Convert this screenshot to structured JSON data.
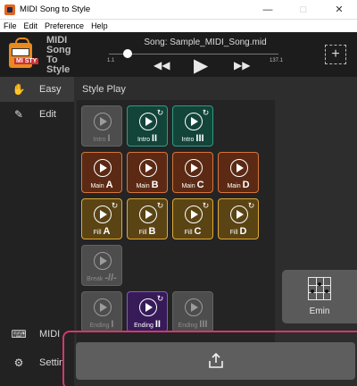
{
  "window": {
    "title": "MIDI Song to Style",
    "minimize_glyph": "—",
    "maximize_glyph": "□",
    "close_glyph": "✕"
  },
  "menu": [
    "File",
    "Edit",
    "Preference",
    "Help"
  ],
  "header": {
    "logo_lines": [
      "MIDI",
      "Song",
      "To",
      "Style"
    ],
    "logo_badge": "MI STY",
    "song_title": "Song: Sample_MIDI_Song.mid",
    "position_start": "1.1",
    "position_end": "137.1",
    "position_fraction": 0.08,
    "rewind_glyph": "◀◀",
    "play_glyph": "▶",
    "forward_glyph": "▶▶",
    "add_glyph": "+"
  },
  "sidebar": {
    "items": [
      {
        "label": "Easy",
        "icon": "easy-hand-icon",
        "glyph": "✋",
        "active": true
      },
      {
        "label": "Edit",
        "icon": "edit-pencil-icon",
        "glyph": "✎",
        "active": false
      },
      {
        "label": "MIDI",
        "icon": "midi-keyboard-icon",
        "glyph": "⌨",
        "active": false
      },
      {
        "label": "Settin",
        "icon": "gear-icon",
        "glyph": "⚙",
        "active": false
      }
    ]
  },
  "main": {
    "title": "Style Play",
    "pads": {
      "intro": [
        {
          "prefix": "Intro",
          "letter": "I",
          "color": "gray",
          "loop": false
        },
        {
          "prefix": "Intro",
          "letter": "II",
          "color": "green",
          "loop": true
        },
        {
          "prefix": "Intro",
          "letter": "III",
          "color": "green",
          "loop": true
        }
      ],
      "main": [
        {
          "prefix": "Main",
          "letter": "A",
          "color": "orange",
          "loop": false
        },
        {
          "prefix": "Main",
          "letter": "B",
          "color": "orange",
          "loop": false
        },
        {
          "prefix": "Main",
          "letter": "C",
          "color": "orange",
          "loop": false
        },
        {
          "prefix": "Main",
          "letter": "D",
          "color": "orange",
          "loop": false
        }
      ],
      "fill": [
        {
          "prefix": "Fill",
          "letter": "A",
          "color": "gold",
          "loop": true
        },
        {
          "prefix": "Fill",
          "letter": "B",
          "color": "gold",
          "loop": true
        },
        {
          "prefix": "Fill",
          "letter": "C",
          "color": "gold",
          "loop": true
        },
        {
          "prefix": "Fill",
          "letter": "D",
          "color": "gold",
          "loop": true
        }
      ],
      "break": [
        {
          "prefix": "Break",
          "letter": "-//-",
          "color": "gray",
          "loop": false
        }
      ],
      "ending": [
        {
          "prefix": "Ending",
          "letter": "I",
          "color": "gray",
          "loop": false
        },
        {
          "prefix": "Ending",
          "letter": "II",
          "color": "purple",
          "loop": true
        },
        {
          "prefix": "Ending",
          "letter": "III",
          "color": "gray",
          "loop": false
        }
      ]
    },
    "loop_glyph": "↻",
    "chord": {
      "name": "Emin",
      "icon": "chord-diagram-icon"
    },
    "share": {
      "icon": "share-export-icon"
    }
  },
  "colors": {
    "accent_easy": "#f0a030",
    "highlight_border": "#d3386a",
    "pad_green": "#2f9c82",
    "pad_orange": "#d8743a",
    "pad_gold": "#e0a836",
    "pad_purple": "#8a56d2"
  }
}
